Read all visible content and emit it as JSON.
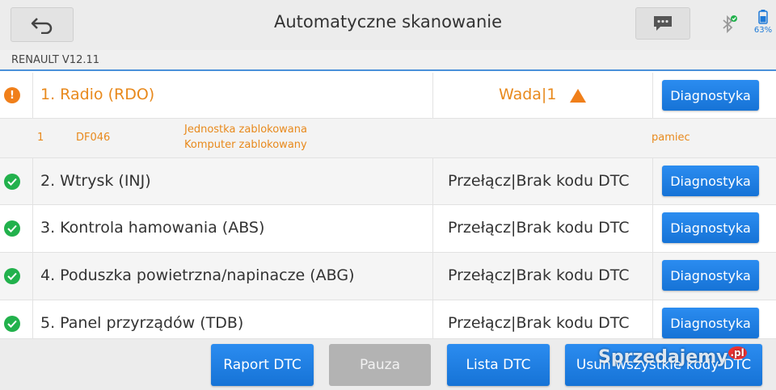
{
  "header": {
    "title": "Automatyczne skanowanie",
    "battery_percent": "63%",
    "back_icon": "back-arrow-icon",
    "message_icon": "chat-icon",
    "bluetooth_icon": "bluetooth-icon"
  },
  "vehicle": "RENAULT V12.11",
  "systems": [
    {
      "name": "1. Radio (RDO)",
      "status": "Wada|1",
      "state": "fault",
      "button": "Diagnostyka"
    },
    {
      "name": "2. Wtrysk (INJ)",
      "status": "Przełącz|Brak kodu DTC",
      "state": "ok",
      "button": "Diagnostyka"
    },
    {
      "name": "3. Kontrola hamowania (ABS)",
      "status": "Przełącz|Brak kodu DTC",
      "state": "ok",
      "button": "Diagnostyka"
    },
    {
      "name": "4. Poduszka powietrzna/napinacze (ABG)",
      "status": "Przełącz|Brak kodu DTC",
      "state": "ok",
      "button": "Diagnostyka"
    },
    {
      "name": "5. Panel przyrządów (TDB)",
      "status": "Przełącz|Brak kodu DTC",
      "state": "ok",
      "button": "Diagnostyka"
    }
  ],
  "dtc": {
    "index": "1",
    "code": "DF046",
    "desc_line1": "Jednostka zablokowana",
    "desc_line2": "Komputer zablokowany",
    "memory": "pamiec"
  },
  "bottom_buttons": {
    "report": "Raport DTC",
    "pause": "Pauza",
    "list": "Lista DTC",
    "clear": "Usuń wszystkie kody DTC"
  },
  "watermark": {
    "text": "Sprzedajemy",
    "suffix": ".pl"
  },
  "colors": {
    "accent_blue": "#1e7ad8",
    "fault_orange": "#f07f1a",
    "ok_green": "#22b14c",
    "disabled_gray": "#b3b3b3"
  }
}
